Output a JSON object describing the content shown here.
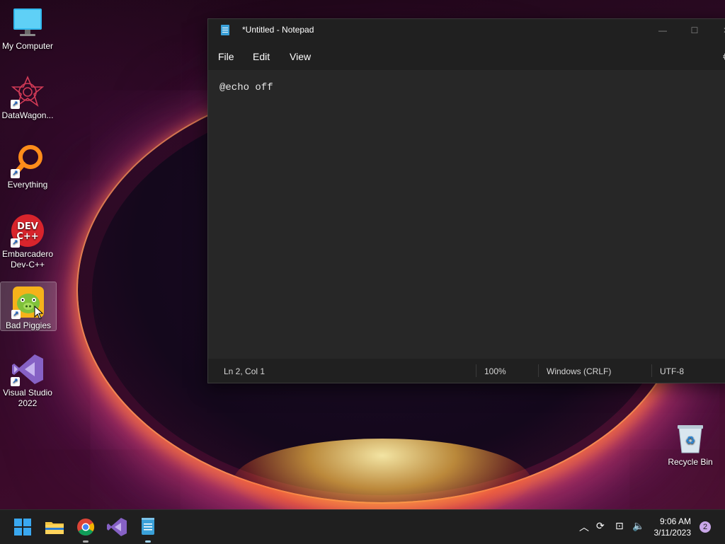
{
  "desktop": {
    "icons": [
      {
        "label": "My Computer",
        "icon": "monitor-icon"
      },
      {
        "label": "DataWagon...",
        "icon": "datawagon-icon"
      },
      {
        "label": "Everything",
        "icon": "everything-search-icon"
      },
      {
        "label": "Embarcadero Dev-C++",
        "icon": "devcpp-icon",
        "icon_text": "DEV C++"
      },
      {
        "label": "Bad Piggies",
        "icon": "bad-piggies-icon"
      },
      {
        "label": "Visual Studio 2022",
        "icon": "visual-studio-icon"
      },
      {
        "label": "Recycle Bin",
        "icon": "recycle-bin-icon"
      }
    ]
  },
  "notepad": {
    "title": "*Untitled - Notepad",
    "menu": [
      "File",
      "Edit",
      "View"
    ],
    "content": "@echo off",
    "status": {
      "position": "Ln 2, Col 1",
      "zoom": "100%",
      "line_ending": "Windows (CRLF)",
      "encoding": "UTF-8"
    }
  },
  "taskbar": {
    "apps": [
      "start-icon",
      "file-explorer-icon",
      "chrome-icon",
      "visual-studio-icon",
      "notepad-icon"
    ],
    "time": "9:06 AM",
    "date": "3/11/2023",
    "notification_count": "2"
  },
  "colors": {
    "accent": "#3aa0d8",
    "window_bg": "#202020",
    "editor_bg": "#272727",
    "taskbar_bg": "#1f1f1f"
  }
}
